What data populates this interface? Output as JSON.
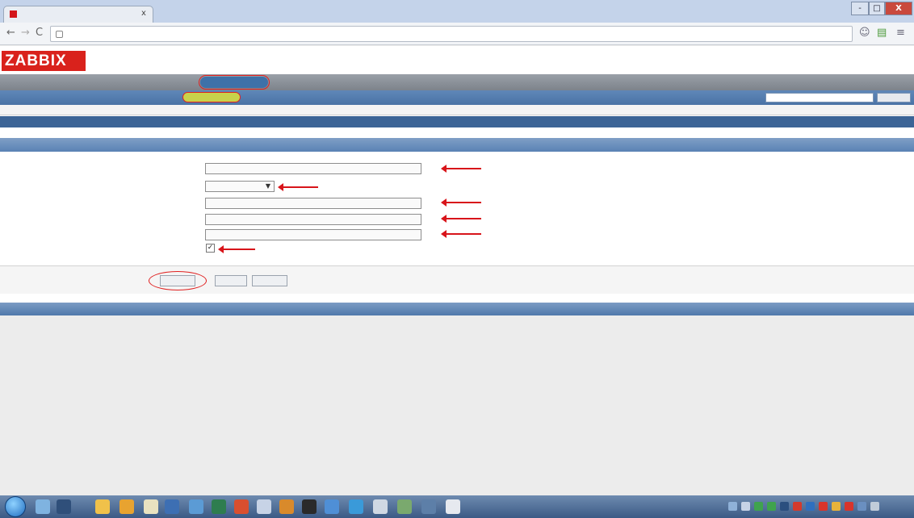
{
  "browser": {
    "tab_title": "",
    "tab_close_glyph": "x",
    "address_text": "",
    "window_controls": {
      "minimize": "-",
      "maximize": "□",
      "close": "X"
    },
    "toolbar_icons": {
      "back": "←",
      "forward": "→",
      "reload": "C",
      "extension_1": "☺",
      "extension_2": "▤",
      "menu": "≡"
    }
  },
  "zabbix": {
    "logo": "ZABBIX",
    "header_links": "",
    "main_menu": [
      {
        "label": ""
      },
      {
        "label": ""
      },
      {
        "label": ""
      },
      {
        "label": ""
      },
      {
        "label": ""
      }
    ],
    "main_menu_right": "",
    "sub_menu": [
      {
        "label": ""
      },
      {
        "label": ""
      },
      {
        "label": ""
      },
      {
        "label": ""
      },
      {
        "label": ""
      },
      {
        "label": ""
      },
      {
        "label": ""
      },
      {
        "label": ""
      },
      {
        "label": ""
      },
      {
        "label": ""
      }
    ],
    "search": {
      "value": "",
      "button": ""
    },
    "history": "",
    "page_title": "",
    "form_title": ""
  },
  "form": {
    "rows": [
      {
        "label": "",
        "value": ""
      },
      {
        "label": "",
        "value": ""
      },
      {
        "label": "",
        "value": ""
      },
      {
        "label": "",
        "value": ""
      },
      {
        "label": "",
        "value": ""
      },
      {
        "label": "",
        "value": ""
      }
    ],
    "type_caret": "▼",
    "enabled_checked": "✓",
    "buttons": {
      "save": "",
      "delete": "",
      "cancel": ""
    }
  },
  "annotations": [
    "",
    "",
    "",
    "",
    "",
    ""
  ],
  "footer": {
    "text": "",
    "right": ""
  },
  "taskbar": {
    "clock": ""
  },
  "colors": {
    "brand_red": "#d9221c",
    "menu_active": "#3e71a8",
    "submenu_active": "#c8d24a",
    "annotation_red": "#d8141a",
    "title_bar": "#3c6496"
  }
}
